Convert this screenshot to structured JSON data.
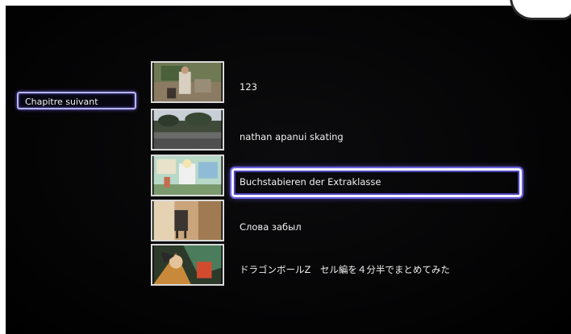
{
  "menu": {
    "chapter_button_label": "Chapitre suivant"
  },
  "playlist": {
    "items": [
      {
        "title": "123",
        "thumbnail": "outdoor-people-thumbnail"
      },
      {
        "title": "nathan apanui skating",
        "thumbnail": "road-trees-thumbnail"
      },
      {
        "title": "Buchstabieren der Extraklasse",
        "thumbnail": "cartoon-scene-thumbnail",
        "selected": true
      },
      {
        "title": "Слова забыл",
        "thumbnail": "room-chair-thumbnail"
      },
      {
        "title": "ドラゴンボールZ　セル編を４分半でまとめてみた",
        "thumbnail": "anime-battle-thumbnail"
      }
    ]
  },
  "colors": {
    "background": "#000000",
    "highlight_border": "#f4f2ff",
    "highlight_glow": "#6b60e0"
  }
}
